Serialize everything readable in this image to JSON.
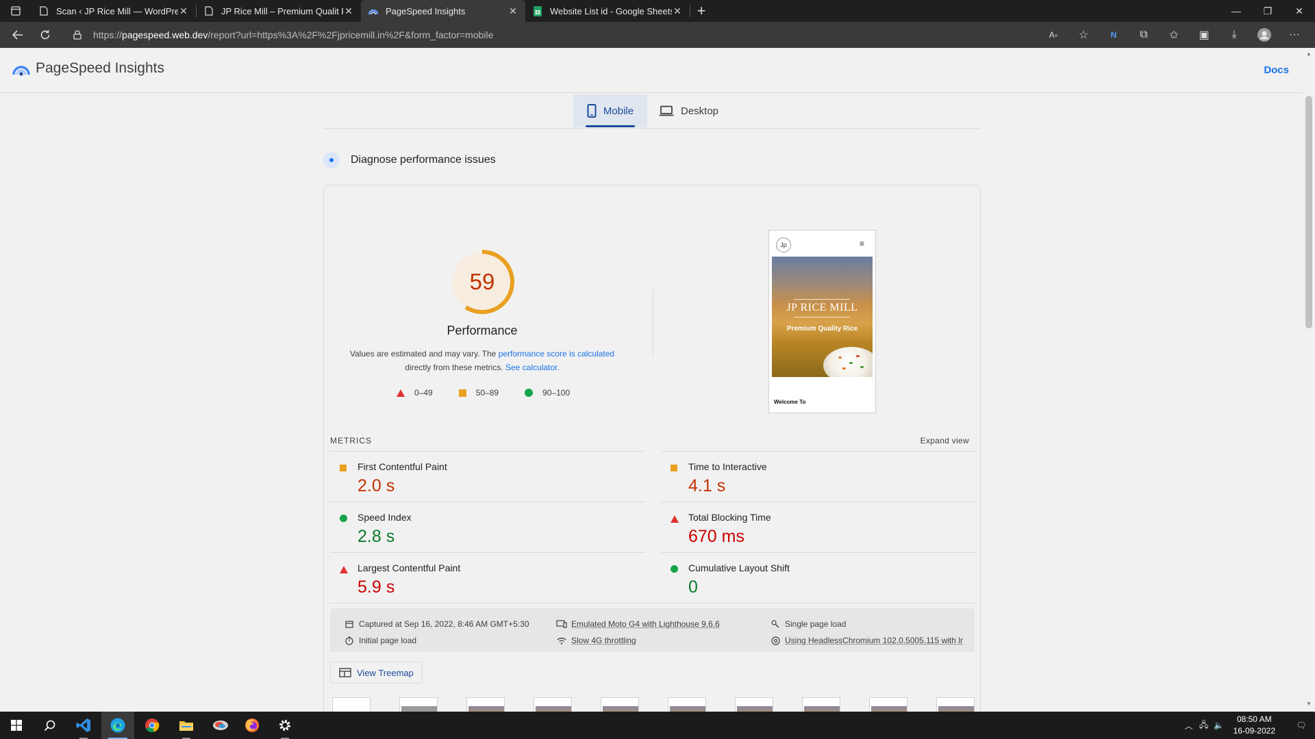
{
  "browser": {
    "tabs": [
      {
        "title": "Scan ‹ JP Rice Mill — WordPress",
        "active": false
      },
      {
        "title": "JP Rice Mill – Premium Qualit Rice",
        "active": false
      },
      {
        "title": "PageSpeed Insights",
        "active": true
      },
      {
        "title": "Website List id - Google Sheets",
        "active": false
      }
    ],
    "url_prefix": "https://",
    "url_host": "pagespeed.web.dev",
    "url_path": "/report?url=https%3A%2F%2Fjpricemill.in%2F&form_factor=mobile"
  },
  "header": {
    "app_title": "PageSpeed Insights",
    "docs_label": "Docs"
  },
  "form_factor": {
    "mobile_label": "Mobile",
    "desktop_label": "Desktop",
    "selected": "Mobile"
  },
  "diagnose_title": "Diagnose performance issues",
  "performance": {
    "score": 59,
    "label": "Performance",
    "note_1": "Values are estimated and may vary. The",
    "note_link_1": "performance score is calculated",
    "note_2": "directly from these metrics.",
    "note_link_2": "See calculator.",
    "legend": [
      {
        "range": "0–49",
        "shape": "triangle",
        "color": "#e03131"
      },
      {
        "range": "50–89",
        "shape": "square",
        "color": "#e8a020"
      },
      {
        "range": "90–100",
        "shape": "circle",
        "color": "#16a34a"
      }
    ]
  },
  "screenshot": {
    "logo_text": "Jp",
    "hero_title": "JP RICE MILL",
    "hero_subtitle": "Premium Quality Rice",
    "welcome_text": "Welcome To"
  },
  "metrics": {
    "heading": "METRICS",
    "expand_label": "Expand view",
    "items": [
      {
        "label": "First Contentful Paint",
        "value": "2.0 s",
        "rating": "average"
      },
      {
        "label": "Time to Interactive",
        "value": "4.1 s",
        "rating": "average"
      },
      {
        "label": "Speed Index",
        "value": "2.8 s",
        "rating": "good"
      },
      {
        "label": "Total Blocking Time",
        "value": "670 ms",
        "rating": "poor"
      },
      {
        "label": "Largest Contentful Paint",
        "value": "5.9 s",
        "rating": "poor"
      },
      {
        "label": "Cumulative Layout Shift",
        "value": "0",
        "rating": "good"
      }
    ]
  },
  "run_info": {
    "captured": "Captured at Sep 16, 2022, 8:46 AM GMT+5:30",
    "device": "Emulated Moto G4 with Lighthouse 9.6.6",
    "load_type": "Single page load",
    "initial_load": "Initial page load",
    "throttling": "Slow 4G throttling",
    "browser": "Using HeadlessChromium 102.0.5005.115 with lr"
  },
  "treemap_label": "View Treemap",
  "taskbar": {
    "time": "08:50 AM",
    "date": "16-09-2022"
  },
  "colors": {
    "average": "#e8a020",
    "good": "#16a34a",
    "poor": "#e03131",
    "link": "#1a73e8"
  }
}
